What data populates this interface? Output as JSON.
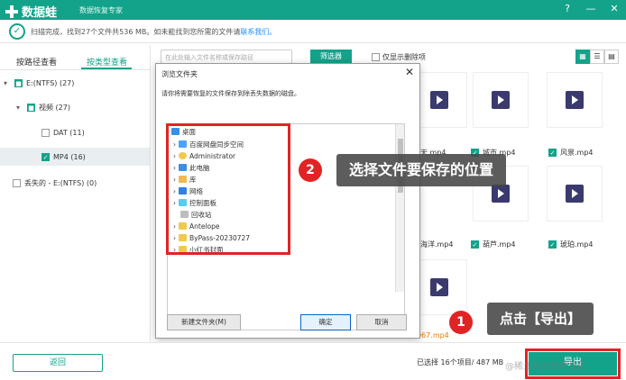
{
  "titlebar": {
    "app_name": "数据蛙",
    "slogan": "数据恢复专家"
  },
  "status": {
    "msg": "扫描完成，找到27个文件共536 MB。如未能找到您所需的文件请",
    "link": "联系我们。"
  },
  "tabs": {
    "path": "按路径查看",
    "type": "按类型查看"
  },
  "toolbar": {
    "search_placeholder": "在此处输入文件名称或保存路径",
    "filter": "筛选器",
    "only_deleted": "仅显示删除项"
  },
  "tree": {
    "drive": "E:(NTFS) (27)",
    "video": "视频 (27)",
    "dat": "DAT (11)",
    "mp4": "MP4 (16)",
    "lost": "丢失的 - E:(NTFS) (0)"
  },
  "files": [
    "天.mp4",
    "城市.mp4",
    "风景.mp4",
    "海洋.mp4",
    "葫芦.mp4",
    "琥珀.mp4",
    "067.mp4"
  ],
  "dialog": {
    "title": "浏览文件夹",
    "desc": "请你将需要恢复的文件保存到除丢失数据的磁盘。",
    "root": "桌面",
    "items": [
      "百度网盘同步空间",
      "Administrator",
      "此电脑",
      "库",
      "网络",
      "控制面板",
      "回收站",
      "Antelope",
      "ByPass-20230727",
      "小红书封面"
    ],
    "new_folder": "新建文件夹(M)",
    "ok": "确定",
    "cancel": "取消"
  },
  "bottom": {
    "back": "返回",
    "selected": "已选择 16个项目/ 487 MB",
    "export": "导出"
  },
  "annotations": {
    "step1_num": "1",
    "step1_text": "点击【导出】",
    "step2_num": "2",
    "step2_text": "选择文件要保存的位置"
  },
  "watermark": "@稀土掘金技术社区",
  "colors": {
    "brand": "#13a38a",
    "highlight": "#e02424"
  }
}
